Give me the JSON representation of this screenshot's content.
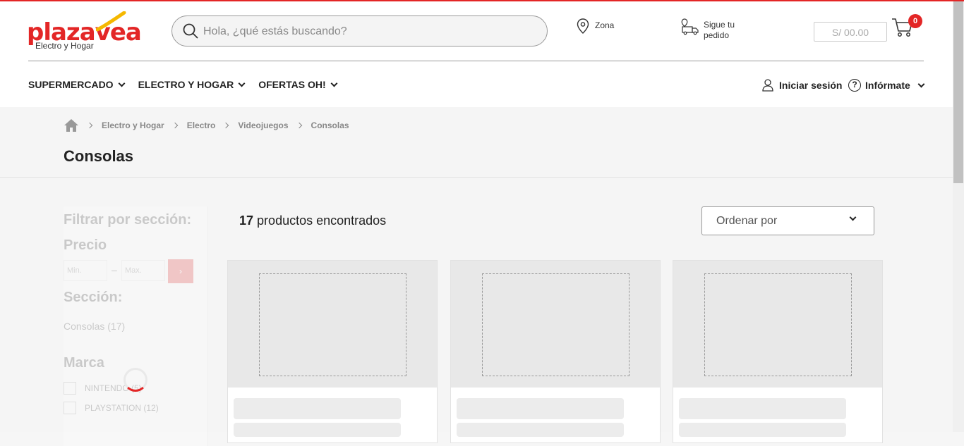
{
  "brand": {
    "name": "plazavea",
    "sub": "Electro y Hogar",
    "color": "#e32626"
  },
  "header": {
    "search_placeholder": "Hola, ¿qué estás buscando?",
    "zona": "Zona",
    "pedido": "Sigue tu pedido",
    "cart_amount": "S/ 00.00",
    "cart_count": "0"
  },
  "nav": {
    "items": [
      "SUPERMERCADO",
      "ELECTRO Y HOGAR",
      "OFERTAS OH!"
    ],
    "login": "Iniciar sesión",
    "informate": "Infórmate"
  },
  "breadcrumb": {
    "items": [
      "Electro y Hogar",
      "Electro",
      "Videojuegos",
      "Consolas"
    ]
  },
  "page": {
    "title": "Consolas",
    "count": "17",
    "count_suffix": "productos encontrados",
    "sort_label": "Ordenar por"
  },
  "filters": {
    "title": "Filtrar por sección:",
    "price_title": "Precio",
    "min_placeholder": "Min.",
    "max_placeholder": "Max.",
    "dash": "–",
    "section_title": "Sección:",
    "section_item": "Consolas (17)",
    "brand_title": "Marca",
    "brands": [
      "NINTENDO (5)",
      "PLAYSTATION (12)"
    ],
    "go_symbol": "›"
  },
  "icons": {
    "search": "search-icon",
    "location": "location-pin-icon",
    "truck": "truck-icon",
    "cart": "cart-icon",
    "user": "user-icon",
    "help": "help-circle-icon",
    "home": "home-icon",
    "help_glyph": "?"
  }
}
